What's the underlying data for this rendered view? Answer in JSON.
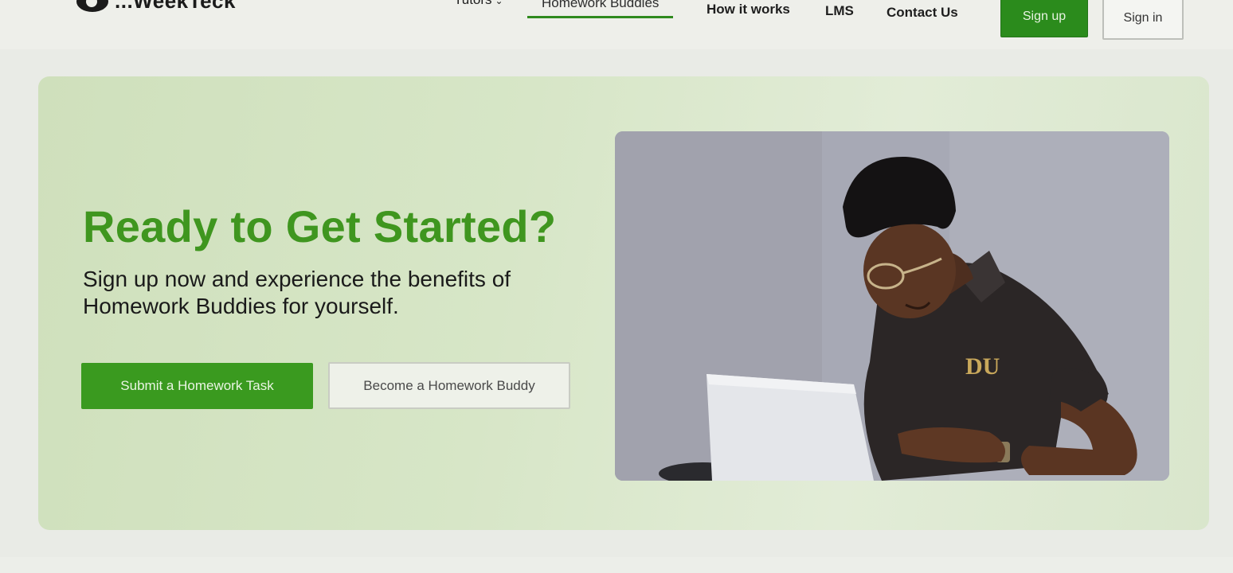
{
  "nav": {
    "logo_text": "...WeekTeck",
    "items": [
      {
        "label": "Tutors",
        "has_dropdown": true
      },
      {
        "label": "Homework Buddies",
        "active": true
      },
      {
        "label": "How it works"
      },
      {
        "label": "LMS"
      },
      {
        "label": "Contact Us"
      }
    ],
    "signup_label": "Sign up",
    "signin_label": "Sign in"
  },
  "hero": {
    "title": "Ready to Get Started?",
    "subtitle": "Sign up now and experience the benefits of Homework Buddies for yourself.",
    "primary_button": "Submit a Homework Task",
    "secondary_button": "Become a Homework Buddy",
    "image_icon": "person-on-laptop-photo",
    "shirt_logo": "DU"
  },
  "colors": {
    "brand_green": "#3a9a1f",
    "hero_bg": "#d7e6c7",
    "title_green": "#3f961f"
  }
}
